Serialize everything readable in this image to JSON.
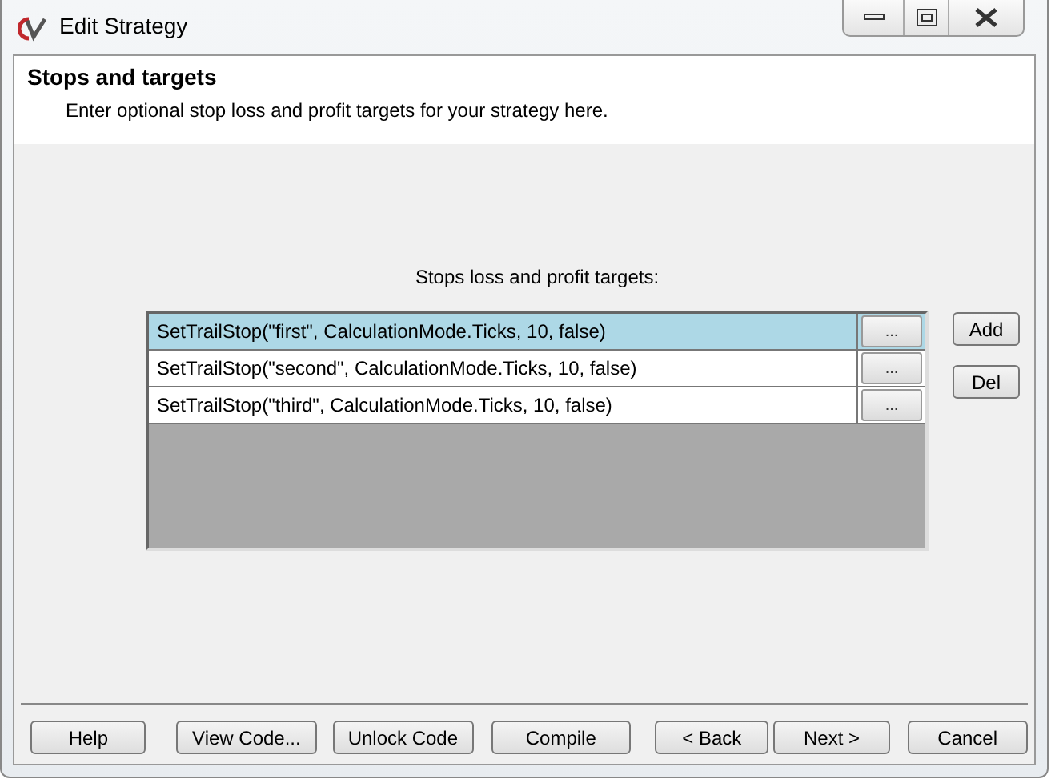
{
  "window": {
    "title": "Edit Strategy"
  },
  "header": {
    "title": "Stops and targets",
    "subtitle": "Enter optional stop loss and profit targets for your strategy here."
  },
  "list_label": "Stops loss and profit targets:",
  "rows": [
    {
      "text": "SetTrailStop(\"first\", CalculationMode.Ticks, 10, false)",
      "button": "...",
      "selected": true
    },
    {
      "text": "SetTrailStop(\"second\", CalculationMode.Ticks, 10, false)",
      "button": "...",
      "selected": false
    },
    {
      "text": "SetTrailStop(\"third\", CalculationMode.Ticks, 10, false)",
      "button": "...",
      "selected": false
    }
  ],
  "side_buttons": [
    "Add",
    "Del"
  ],
  "footer_buttons": [
    "Help",
    "View Code...",
    "Unlock Code",
    "Compile",
    "< Back",
    "Next >",
    "Cancel"
  ]
}
